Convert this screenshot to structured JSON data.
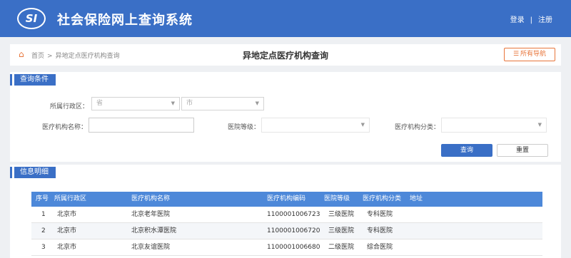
{
  "header": {
    "logo_text": "SI",
    "title": "社会保险网上查询系统",
    "login_label": "登录",
    "separator": "|",
    "register_label": "注册"
  },
  "titlebar": {
    "breadcrumb_home": "首页",
    "breadcrumb_arrow": ">",
    "breadcrumb_current": "异地定点医疗机构查询",
    "page_title": "异地定点医疗机构查询",
    "all_button_icon": "☰",
    "all_button_label": "所有导航"
  },
  "query": {
    "section_title": "查询条件",
    "region_label": "所属行政区：",
    "province_value": "省",
    "city_value": "市",
    "name_label": "医疗机构名称：",
    "name_value": "",
    "level_label": "医院等级：",
    "level_value": "",
    "category_label": "医疗机构分类：",
    "category_value": "",
    "query_button": "查询",
    "reset_button": "重置"
  },
  "details": {
    "section_title": "信息明细",
    "columns": [
      "序号",
      "所属行政区",
      "医疗机构名称",
      "医疗机构编码",
      "医院等级",
      "医疗机构分类",
      "地址"
    ],
    "rows": [
      [
        "1",
        "北京市",
        "北京老年医院",
        "1100001006723",
        "三级医院",
        "专科医院",
        ""
      ],
      [
        "2",
        "北京市",
        "北京积水潭医院",
        "1100001006720",
        "三级医院",
        "专科医院",
        ""
      ],
      [
        "3",
        "北京市",
        "北京友谊医院",
        "1100001006680",
        "二级医院",
        "综合医院",
        ""
      ]
    ]
  },
  "colors": {
    "brand_blue": "#3a6fc6",
    "table_header": "#4d88d9",
    "accent_orange": "#e8753a"
  },
  "icons": {
    "home": "home-icon",
    "menu": "menu-icon",
    "dropdown": "chevron-down-icon"
  }
}
